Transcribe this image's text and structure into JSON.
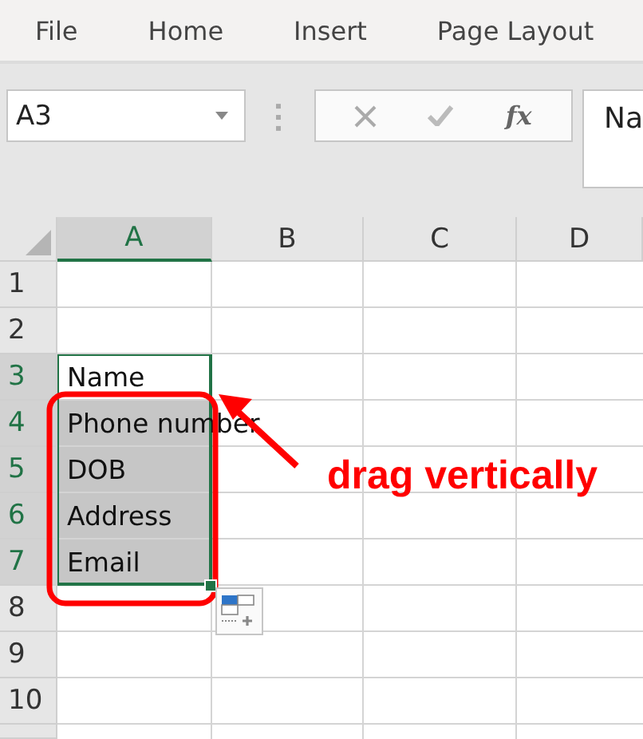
{
  "menu_tabs": [
    "File",
    "Home",
    "Insert",
    "Page Layout"
  ],
  "name_box": {
    "value": "A3"
  },
  "formula_bar": {
    "function_label": "fx",
    "content": "Na"
  },
  "columns": [
    {
      "label": "A",
      "selected": true
    },
    {
      "label": "B",
      "selected": false
    },
    {
      "label": "C",
      "selected": false
    },
    {
      "label": "D",
      "selected": false
    }
  ],
  "rows": [
    {
      "label": "1",
      "selected": false
    },
    {
      "label": "2",
      "selected": false
    },
    {
      "label": "3",
      "selected": true,
      "cells": [
        {
          "text": "Name",
          "selected": true,
          "active": true
        }
      ]
    },
    {
      "label": "4",
      "selected": true,
      "cells": [
        {
          "text": "Phone number",
          "selected": true,
          "active": false
        }
      ]
    },
    {
      "label": "5",
      "selected": true,
      "cells": [
        {
          "text": "DOB",
          "selected": true,
          "active": false
        }
      ]
    },
    {
      "label": "6",
      "selected": true,
      "cells": [
        {
          "text": "Address",
          "selected": true,
          "active": false
        }
      ]
    },
    {
      "label": "7",
      "selected": true,
      "cells": [
        {
          "text": "Email",
          "selected": true,
          "active": false
        }
      ]
    },
    {
      "label": "8",
      "selected": false
    },
    {
      "label": "9",
      "selected": false
    },
    {
      "label": "10",
      "selected": false
    }
  ],
  "annotation": {
    "text": "drag vertically"
  }
}
